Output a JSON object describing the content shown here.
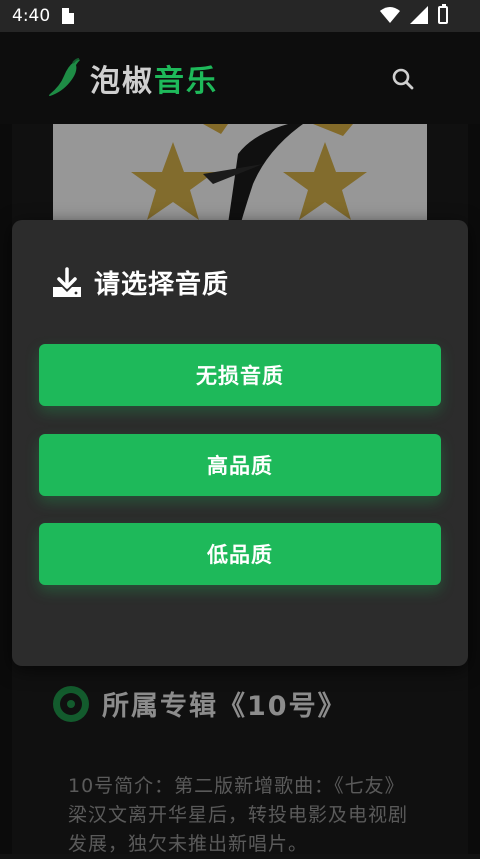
{
  "status_bar": {
    "time": "4:40"
  },
  "header": {
    "app_name_part1": "泡椒",
    "app_name_part2": "音乐"
  },
  "album": {
    "title": "所属专辑《10号》",
    "description": "10号简介：第二版新增歌曲：《七友》 梁汉文离开华星后，转投电影及电视剧发展，独欠未推出新唱片。"
  },
  "dialog": {
    "title": "请选择音质",
    "options": [
      "无损音质",
      "高品质",
      "低品质"
    ]
  },
  "colors": {
    "accent": "#1eb95a",
    "dialog_bg": "#2c2c2c",
    "page_bg": "#121212"
  }
}
